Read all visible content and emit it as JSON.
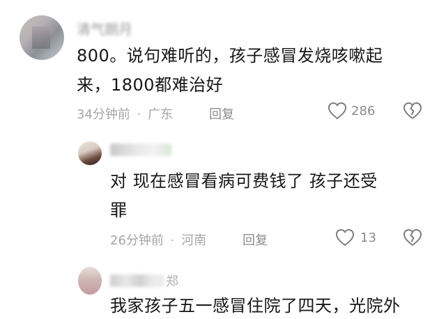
{
  "comments": [
    {
      "author": "清气朗月",
      "text_line1": "800。说句难听的，孩子感冒发烧咳嗽起",
      "text_line2": "来，1800都难治好",
      "time": "34分钟前",
      "dot": "·",
      "location": "广东",
      "reply_label": "回复",
      "likes": "286",
      "like_icon": "heart-outline",
      "dislike_icon": "broken-heart-outline"
    },
    {
      "text_line1": "对 现在感冒看病可费钱了 孩子还受",
      "text_line2": "罪",
      "time": "26分钟前",
      "dot": "·",
      "location": "河南",
      "reply_label": "回复",
      "likes": "13"
    },
    {
      "author_suffix": "郑",
      "text_line1": "我家孩子五一感冒住院了四天，光院外"
    }
  ],
  "colors": {
    "text": "#161616",
    "meta": "#a6a6a6",
    "icon": "#7d7d7d"
  }
}
